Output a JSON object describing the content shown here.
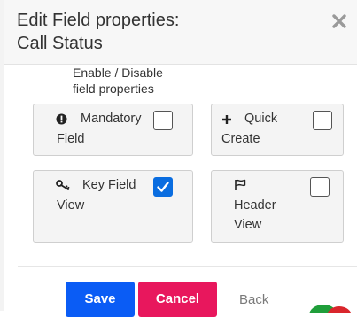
{
  "dialog": {
    "title_line1": "Edit Field properties:",
    "title_line2": "Call Status",
    "description_line1": "Enable / Disable",
    "description_line2": "field properties"
  },
  "options": {
    "mandatory": {
      "label_line1": "Mandatory",
      "label_line2": "Field",
      "checked": false,
      "icon": "exclamation-circle-icon"
    },
    "quick_create": {
      "label_line1": "Quick",
      "label_line2": "Create",
      "checked": false,
      "icon": "plus-icon"
    },
    "key_field": {
      "label_line1": "Key Field",
      "label_line2": "View",
      "checked": true,
      "icon": "key-icon"
    },
    "header_view": {
      "label_line1": "Header",
      "label_line2": "View",
      "checked": false,
      "icon": "flag-icon"
    }
  },
  "footer": {
    "save_label": "Save",
    "cancel_label": "Cancel",
    "back_label": "Back"
  },
  "colors": {
    "save": "#0a5cf5",
    "cancel": "#e8175d",
    "checkbox_checked": "#0a6de0",
    "header_bg": "#f7f7f7"
  }
}
